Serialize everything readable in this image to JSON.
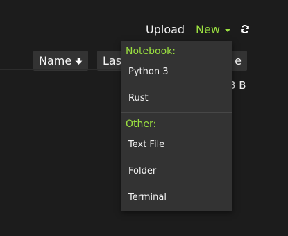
{
  "toolbar": {
    "upload_label": "Upload",
    "new_label": "New",
    "refresh_icon": "refresh-icon"
  },
  "columns": {
    "name": "Name",
    "last_partial": "Last",
    "size_partial": "e"
  },
  "file_size_partial": "3 B",
  "dropdown": {
    "notebook_header": "Notebook:",
    "notebook_items": [
      "Python 3",
      "Rust"
    ],
    "other_header": "Other:",
    "other_items": [
      "Text File",
      "Folder",
      "Terminal"
    ]
  },
  "colors": {
    "accent": "#9be040",
    "background": "#1c1c1c",
    "menu_background": "#333333"
  }
}
